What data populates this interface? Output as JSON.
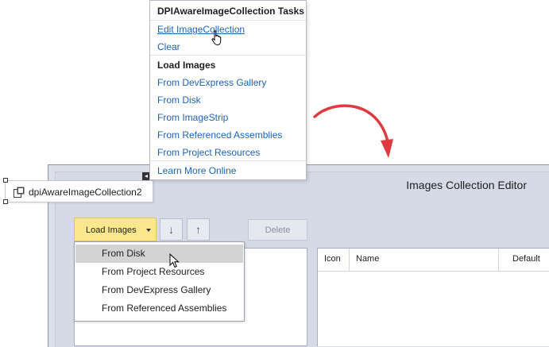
{
  "editor": {
    "title": "Images Collection Editor",
    "load_images_label": "Load Images",
    "move_down_glyph": "↓",
    "move_up_glyph": "↑",
    "delete_label": "Delete",
    "grid_columns": [
      "Icon",
      "Name",
      "Default"
    ]
  },
  "dropdown": {
    "items": [
      "From Disk",
      "From Project Resources",
      "From DevExpress Gallery",
      "From Referenced Assemblies"
    ],
    "highlighted_index": 0
  },
  "component": {
    "name": "dpiAwareImageCollection2",
    "icon": "image-collection-icon",
    "smart_tag_glyph": "◂"
  },
  "tasks": {
    "title": "DPIAwareImageCollection Tasks",
    "edit_label": "Edit ImageCollection",
    "clear_label": "Clear",
    "load_header": "Load Images",
    "load_links": [
      "From DevExpress Gallery",
      "From Disk",
      "From ImageStrip",
      "From Referenced Assemblies",
      "From Project Resources"
    ],
    "learn_more_label": "Learn More Online"
  },
  "colors": {
    "link": "#1c63b7",
    "accent_button": "#fbe88d",
    "arrow": "#e0393e",
    "editor_background": "#dcdfe9"
  },
  "icons": [
    "hand-pointer-cursor-icon",
    "arrow-cursor-icon",
    "curved-arrow-icon",
    "chevron-down-icon"
  ]
}
